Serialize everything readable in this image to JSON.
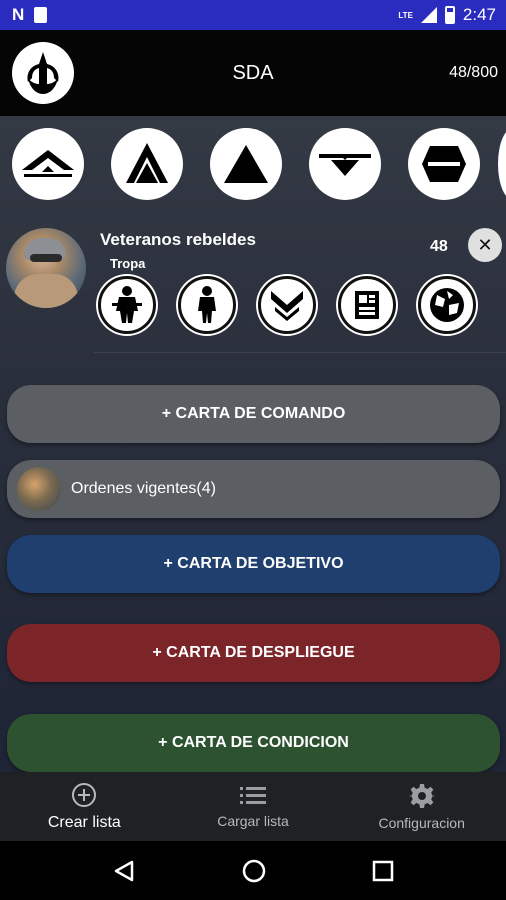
{
  "status_bar": {
    "time": "2:47",
    "network": "LTE",
    "icons": [
      "notification-n-icon",
      "sd-card-icon",
      "signal-icon",
      "battery-icon"
    ]
  },
  "app_bar": {
    "logo_icon": "rebel-alliance-icon",
    "title": "SDA",
    "points": "48/800"
  },
  "factions": [
    {
      "icon": "rank-commander-icon"
    },
    {
      "icon": "rank-operative-icon"
    },
    {
      "icon": "rank-corps-icon"
    },
    {
      "icon": "rank-special-forces-icon"
    },
    {
      "icon": "rank-support-icon"
    }
  ],
  "unit": {
    "name": "Veteranos rebeldes",
    "type": "Tropa",
    "points": "48",
    "upgrades": [
      {
        "icon": "heavy-weapon-trooper-icon"
      },
      {
        "icon": "personnel-trooper-icon"
      },
      {
        "icon": "training-chevron-icon"
      },
      {
        "icon": "gear-device-icon"
      },
      {
        "icon": "grenade-globe-icon"
      }
    ]
  },
  "buttons": {
    "comando": "+ CARTA DE COMANDO",
    "orders": "Ordenes vigentes(4)",
    "objetivo": "+ CARTA DE OBJETIVO",
    "despliegue": "+ CARTA DE DESPLIEGUE",
    "condicion": "+ CARTA DE CONDICION"
  },
  "bottom_nav": [
    {
      "label": "Crear lista",
      "icon": "add-circle-icon",
      "active": true
    },
    {
      "label": "Cargar lista",
      "icon": "list-icon",
      "active": false
    },
    {
      "label": "Configuracion",
      "icon": "settings-icon",
      "active": false
    }
  ],
  "system_nav": [
    "back-icon",
    "home-icon",
    "recents-icon"
  ],
  "colors": {
    "status_bar": "#2a2cc0",
    "comando": "#5b5e62",
    "objetivo": "#1f3f6e",
    "despliegue": "#7c2529",
    "condicion": "#2c5230"
  }
}
